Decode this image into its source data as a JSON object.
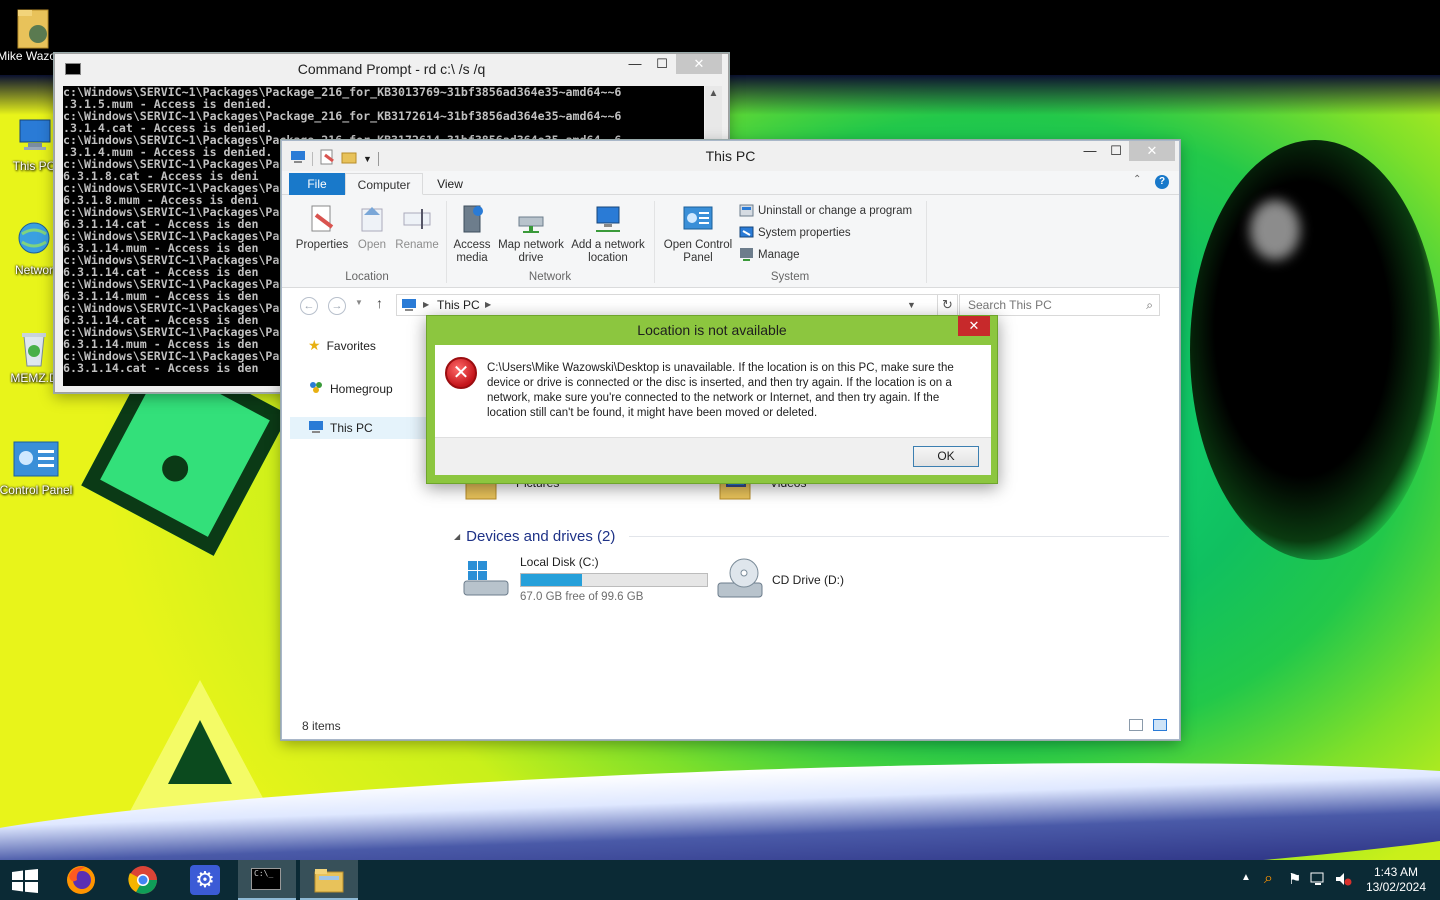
{
  "desktop": {
    "icons": [
      {
        "label": "Mike Wazows"
      },
      {
        "label": "This PC"
      },
      {
        "label": "Networ"
      },
      {
        "label": "MEMZ.D"
      },
      {
        "label": "Control Panel"
      }
    ]
  },
  "cmd": {
    "title": "Command Prompt - rd  c:\\ /s /q",
    "lines": [
      "c:\\Windows\\SERVIC~1\\Packages\\Package_216_for_KB3013769~31bf3856ad364e35~amd64~~6",
      ".3.1.5.mum - Access is denied.",
      "c:\\Windows\\SERVIC~1\\Packages\\Package_216_for_KB3172614~31bf3856ad364e35~amd64~~6",
      ".3.1.4.cat - Access is denied.",
      "c:\\Windows\\SERVIC~1\\Packages\\Package_216_for_KB3172614~31bf3856ad364e35~amd64~~6",
      ".3.1.4.mum - Access is denied.",
      "c:\\Windows\\SERVIC~1\\Packages\\Package",
      "6.3.1.8.cat - Access is deni",
      "c:\\Windows\\SERVIC~1\\Packages\\Package",
      "6.3.1.8.mum - Access is deni",
      "c:\\Windows\\SERVIC~1\\Packages\\Package",
      "6.3.1.14.cat - Access is den",
      "c:\\Windows\\SERVIC~1\\Packages\\Package",
      "6.3.1.14.mum - Access is den",
      "c:\\Windows\\SERVIC~1\\Packages\\Package",
      "6.3.1.14.cat - Access is den",
      "c:\\Windows\\SERVIC~1\\Packages\\Package",
      "6.3.1.14.mum - Access is den",
      "c:\\Windows\\SERVIC~1\\Packages\\Package",
      "6.3.1.14.cat - Access is den",
      "c:\\Windows\\SERVIC~1\\Packages\\Package",
      "6.3.1.14.mum - Access is den",
      "c:\\Windows\\SERVIC~1\\Packages\\Package",
      "6.3.1.14.cat - Access is den"
    ]
  },
  "explorer": {
    "title": "This PC",
    "tabs": {
      "file": "File",
      "computer": "Computer",
      "view": "View"
    },
    "ribbon": {
      "properties": "Properties",
      "open": "Open",
      "rename": "Rename",
      "access_media": "Access media",
      "map_drive": "Map network drive",
      "add_location": "Add a network location",
      "open_control_panel": "Open Control Panel",
      "uninstall": "Uninstall or change a program",
      "system_properties": "System properties",
      "manage": "Manage",
      "group_location": "Location",
      "group_network": "Network",
      "group_system": "System"
    },
    "address": "This PC",
    "search_placeholder": "Search This PC",
    "nav": {
      "favorites": "Favorites",
      "homegroup": "Homegroup",
      "this_pc": "This PC"
    },
    "folders": {
      "pictures": "Pictures",
      "videos": "Videos"
    },
    "devices_header": "Devices and drives (2)",
    "drives": [
      {
        "name": "Local Disk (C:)",
        "free_text": "67.0 GB free of 99.6 GB",
        "used_fraction": 0.327
      },
      {
        "name": "CD Drive (D:)"
      }
    ],
    "status": "8 items"
  },
  "dialog": {
    "title": "Location is not available",
    "message": "C:\\Users\\Mike Wazowski\\Desktop is unavailable. If the location is on this PC, make sure the device or drive is connected or the disc is inserted, and then try again. If the location is on a network, make sure you're connected to the network or Internet, and then try again. If the location still can't be found, it might have been moved or deleted.",
    "ok": "OK",
    "close": "✕"
  },
  "taskbar": {
    "time": "1:43 AM",
    "date": "13/02/2024"
  },
  "colors": {
    "dialog_frame": "#8cc63f",
    "file_tab": "#1979ca",
    "taskbar": "#0b2a35",
    "drive_bar": "#26a0da"
  }
}
